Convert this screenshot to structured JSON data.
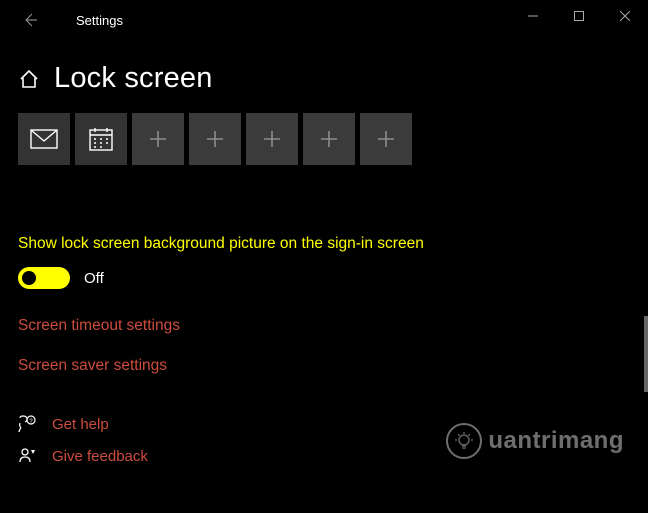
{
  "window": {
    "title": "Settings"
  },
  "page": {
    "title": "Lock screen"
  },
  "tiles": {
    "items": [
      "mail",
      "calendar",
      "add",
      "add",
      "add",
      "add",
      "add"
    ]
  },
  "setting": {
    "label": "Show lock screen background picture on the sign-in screen",
    "state": "Off"
  },
  "links": {
    "timeout": "Screen timeout settings",
    "saver": "Screen saver settings"
  },
  "footer": {
    "help": "Get help",
    "feedback": "Give feedback"
  },
  "watermark": "uantrimang",
  "colors": {
    "accent": "#ffff00",
    "link": "#cc4d3d",
    "bg": "#000000"
  }
}
